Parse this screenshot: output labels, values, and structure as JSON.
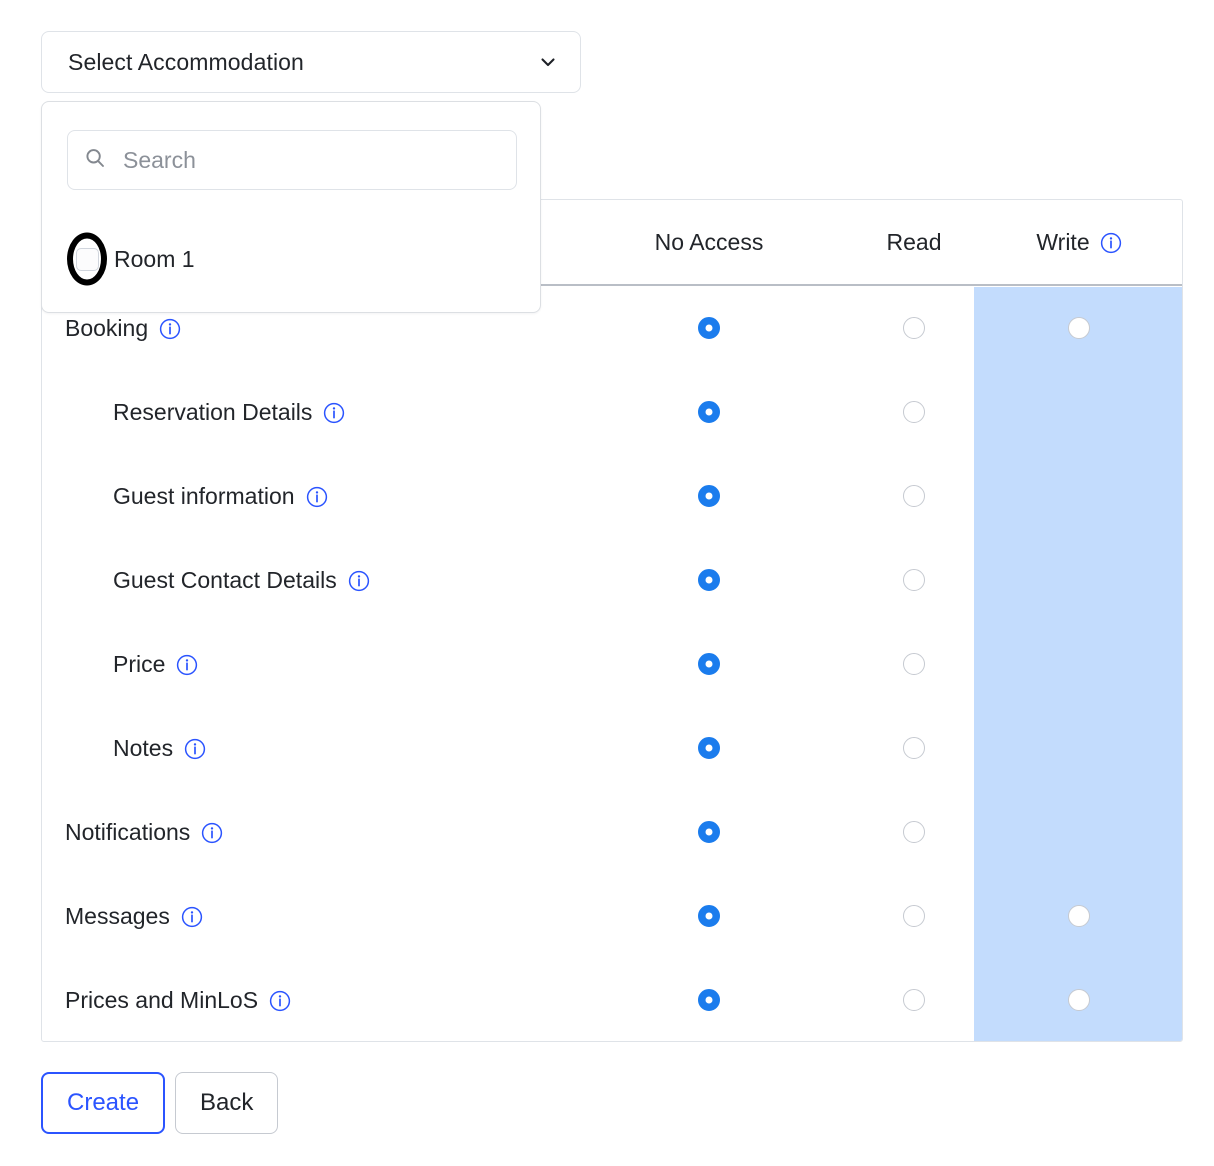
{
  "accommodation_select": {
    "label": "Select Accommodation",
    "chevron_icon": "chevron-down-icon",
    "expanded": true
  },
  "dropdown": {
    "search": {
      "placeholder": "Search",
      "value": "",
      "icon": "search-icon"
    },
    "options": [
      {
        "label": "Room 1",
        "checked": false,
        "annotated": true
      }
    ]
  },
  "table": {
    "columns": [
      {
        "key": "feature",
        "label": ""
      },
      {
        "key": "no_access",
        "label": "No Access"
      },
      {
        "key": "read",
        "label": "Read"
      },
      {
        "key": "write",
        "label": "Write",
        "info_icon": "info-icon"
      }
    ],
    "write_column_highlight_color": "#c3dcfd",
    "selected_radio_color": "#1b7ced",
    "rows": [
      {
        "label": "Booking",
        "indent": false,
        "info_icon": "info-icon",
        "no_access": "on",
        "read": "off",
        "write": "off"
      },
      {
        "label": "Reservation Details",
        "indent": true,
        "info_icon": "info-icon",
        "no_access": "on",
        "read": "off",
        "write": "none"
      },
      {
        "label": "Guest information",
        "indent": true,
        "info_icon": "info-icon",
        "no_access": "on",
        "read": "off",
        "write": "none"
      },
      {
        "label": "Guest Contact Details",
        "indent": true,
        "info_icon": "info-icon",
        "no_access": "on",
        "read": "off",
        "write": "none"
      },
      {
        "label": "Price",
        "indent": true,
        "info_icon": "info-icon",
        "no_access": "on",
        "read": "off",
        "write": "none"
      },
      {
        "label": "Notes",
        "indent": true,
        "info_icon": "info-icon",
        "no_access": "on",
        "read": "off",
        "write": "none"
      },
      {
        "label": "Notifications",
        "indent": false,
        "info_icon": "info-icon",
        "no_access": "on",
        "read": "off",
        "write": "none"
      },
      {
        "label": "Messages",
        "indent": false,
        "info_icon": "info-icon",
        "no_access": "on",
        "read": "off",
        "write": "off"
      },
      {
        "label": "Prices and MinLoS",
        "indent": false,
        "info_icon": "info-icon",
        "no_access": "on",
        "read": "off",
        "write": "off"
      }
    ]
  },
  "footer": {
    "create_label": "Create",
    "back_label": "Back"
  },
  "colors": {
    "accent_blue": "#2b54ff",
    "radio_blue": "#1b7ced",
    "info_blue": "#2b54ff",
    "write_highlight": "#c3dcfd",
    "text": "#22252a",
    "border": "#dfe3e8"
  }
}
